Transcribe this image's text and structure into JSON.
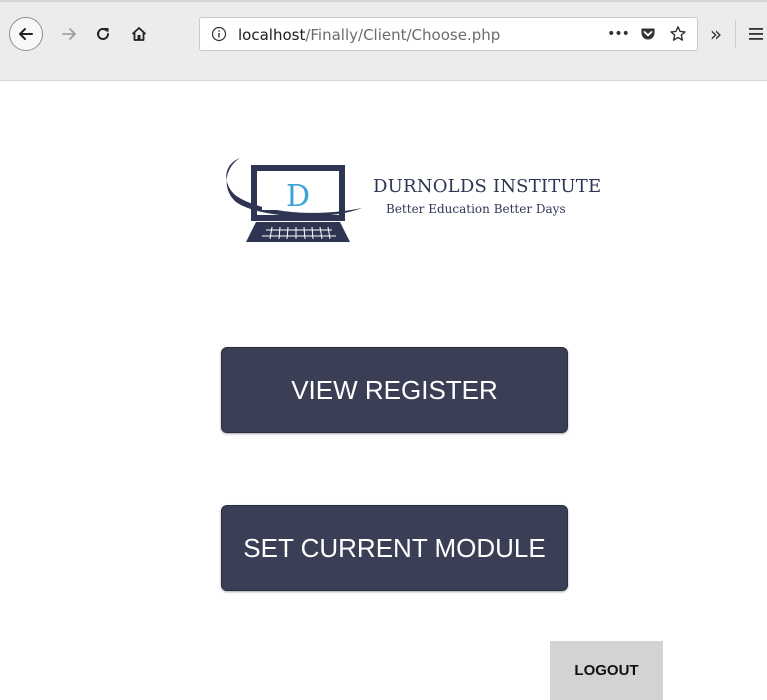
{
  "browser": {
    "url_host": "localhost",
    "url_path": "/Finally/Client/Choose.php",
    "icons": {
      "back": "arrow-left-icon",
      "forward": "arrow-right-icon",
      "reload": "reload-icon",
      "home": "home-icon",
      "info": "info-icon",
      "more": "ellipsis-icon",
      "pocket": "pocket-icon",
      "bookmark": "star-icon",
      "overflow": "chevron-double-right-icon",
      "menu": "hamburger-menu-icon"
    },
    "overflow_glyph": "»",
    "more_glyph": "•••"
  },
  "brand": {
    "letter": "D",
    "name": "DURNOLDS INSTITUTE",
    "tagline": "Better Education Better Days",
    "colors": {
      "navy": "#2e3553",
      "accent": "#3aa5d6"
    }
  },
  "actions": {
    "view_register": "VIEW REGISTER",
    "set_current_module": "SET CURRENT MODULE",
    "logout": "LOGOUT"
  },
  "colors": {
    "button_bg": "#3b3f55",
    "button_text": "#ffffff",
    "logout_bg": "#d3d3d3"
  }
}
